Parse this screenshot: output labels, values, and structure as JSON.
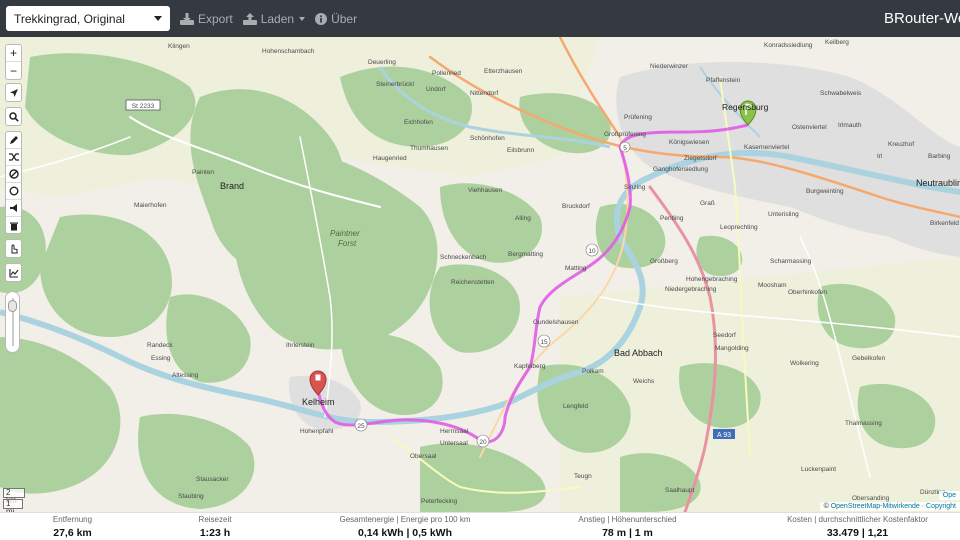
{
  "navbar": {
    "profile_select": "Trekkingrad, Original",
    "export_label": "Export",
    "load_label": "Laden",
    "about_label": "Über",
    "brand": "BRouter-Web"
  },
  "map": {
    "route_color": "#e05ce6",
    "labels": {
      "klingen": "Klingen",
      "hohenschambach": "Hohenschambach",
      "deuerling": "Deuerling",
      "pollenried": "Pollenried",
      "etterzhausen": "Etterzhausen",
      "steinerbruckl": "Steinerbrückl",
      "undorf": "Undorf",
      "nittendorf": "Nittendorf",
      "eichhofen": "Eichhofen",
      "thumhausen": "Thumhausen",
      "schoenhofen": "Schönhofen",
      "haugenried": "Haugenried",
      "eilsbrunn": "Eilsbrunn",
      "painten": "Painten",
      "brand": "Brand",
      "maierhofen": "Maierhofen",
      "paintner": "Paintner",
      "forst": "Forst",
      "viehhausen": "Viehhausen",
      "alling": "Alling",
      "schneckenbach": "Schneckenbach",
      "bergmatting": "Bergmatting",
      "reichenstetten": "Reichenstetten",
      "matting": "Matting",
      "gundelshausen": "Gundelshausen",
      "kapfelberg": "Kapfelberg",
      "poikam": "Poikam",
      "bad_abbach": "Bad Abbach",
      "weichs": "Weichs",
      "randeck": "Randeck",
      "essing": "Essing",
      "altessing": "Altessing",
      "ihrlerstein": "Ihrlerstein",
      "kelheim": "Kelheim",
      "hohenpfahl": "Hohenpfahl",
      "herrnsaal": "Herrnsaal",
      "untersaal": "Untersaal",
      "obersaal": "Obersaal",
      "lengfeld": "Lengfeld",
      "stausacker": "Stausacker",
      "staubing": "Staubing",
      "peterfecking": "Peterfecking",
      "teugn": "Teugn",
      "saalhaupt": "Saalhaupt",
      "regensburg": "Regensburg",
      "konradssiedlung": "Konradssiedlung",
      "keilberg": "Keilberg",
      "pfaffenstein": "Pfaffenstein",
      "niederwinzer": "Niederwinzer",
      "schwabelweis": "Schwabelweis",
      "prufening": "Prüfening",
      "grossprufening": "Großprüfening",
      "koenigswiesen": "Königswiesen",
      "ostenviertel": "Ostenviertel",
      "irlmauth": "Irlmauth",
      "kasernenviertel": "Kasernenviertel",
      "ziegetsdorf": "Ziegetsdorf",
      "kreuzhof": "Kreuzhof",
      "irl": "Irl",
      "barbing": "Barbing",
      "ganghofersiedlung": "Ganghofersiedlung",
      "burgweinting": "Burgweinting",
      "neutraubling": "Neutraubling",
      "graß": "Graß",
      "sinzing": "Sinzing",
      "bruckdorf": "Bruckdorf",
      "pentling": "Pentling",
      "unterisling": "Unterisling",
      "leoprechting": "Leoprechting",
      "birkenfeld": "Birkenfeld",
      "grossberg": "Großberg",
      "scharmassing": "Scharmassing",
      "hohengebraching": "Hohengebraching",
      "niedergebraching": "Niedergebraching",
      "moosham": "Moosham",
      "oberhinkofen": "Oberhinkofen",
      "seedorf": "Seedorf",
      "mangolding": "Mangolding",
      "wolkering": "Wolkering",
      "gebelkofen": "Gebelkofen",
      "thalmassing": "Thalmassing",
      "luckenpaint": "Luckenpaint",
      "obersanding": "Obersanding",
      "dunzling": "Dünzling",
      "st2233": "St 2233",
      "a93": "A 93",
      "r5": "5",
      "r10": "10",
      "r15": "15",
      "r20": "20",
      "r25": "25"
    },
    "controls": {
      "zoom_in": "+",
      "zoom_out": "−"
    },
    "scale_km": "2 km",
    "scale_mi": "1 mi",
    "attribution_prefix": "©",
    "attribution_osm": "OpenStreetMap-Mitwirkende",
    "attribution_sep": " · ",
    "attribution_copyright": "Copyright",
    "attribution_top": "Ope"
  },
  "stats": [
    {
      "label": "Entfernung",
      "value": "27,6 km"
    },
    {
      "label": "Reisezeit",
      "value": "1:23 h"
    },
    {
      "label": "Gesamtenergie | Energie pro 100 km",
      "value": "0,14 kWh | 0,5 kWh"
    },
    {
      "label": "Anstieg | Höhenunterschied",
      "value": "78 m | 1 m"
    },
    {
      "label": "Kosten | durchschnittlicher Kostenfaktor",
      "value": "33.479 | 1,21"
    }
  ]
}
